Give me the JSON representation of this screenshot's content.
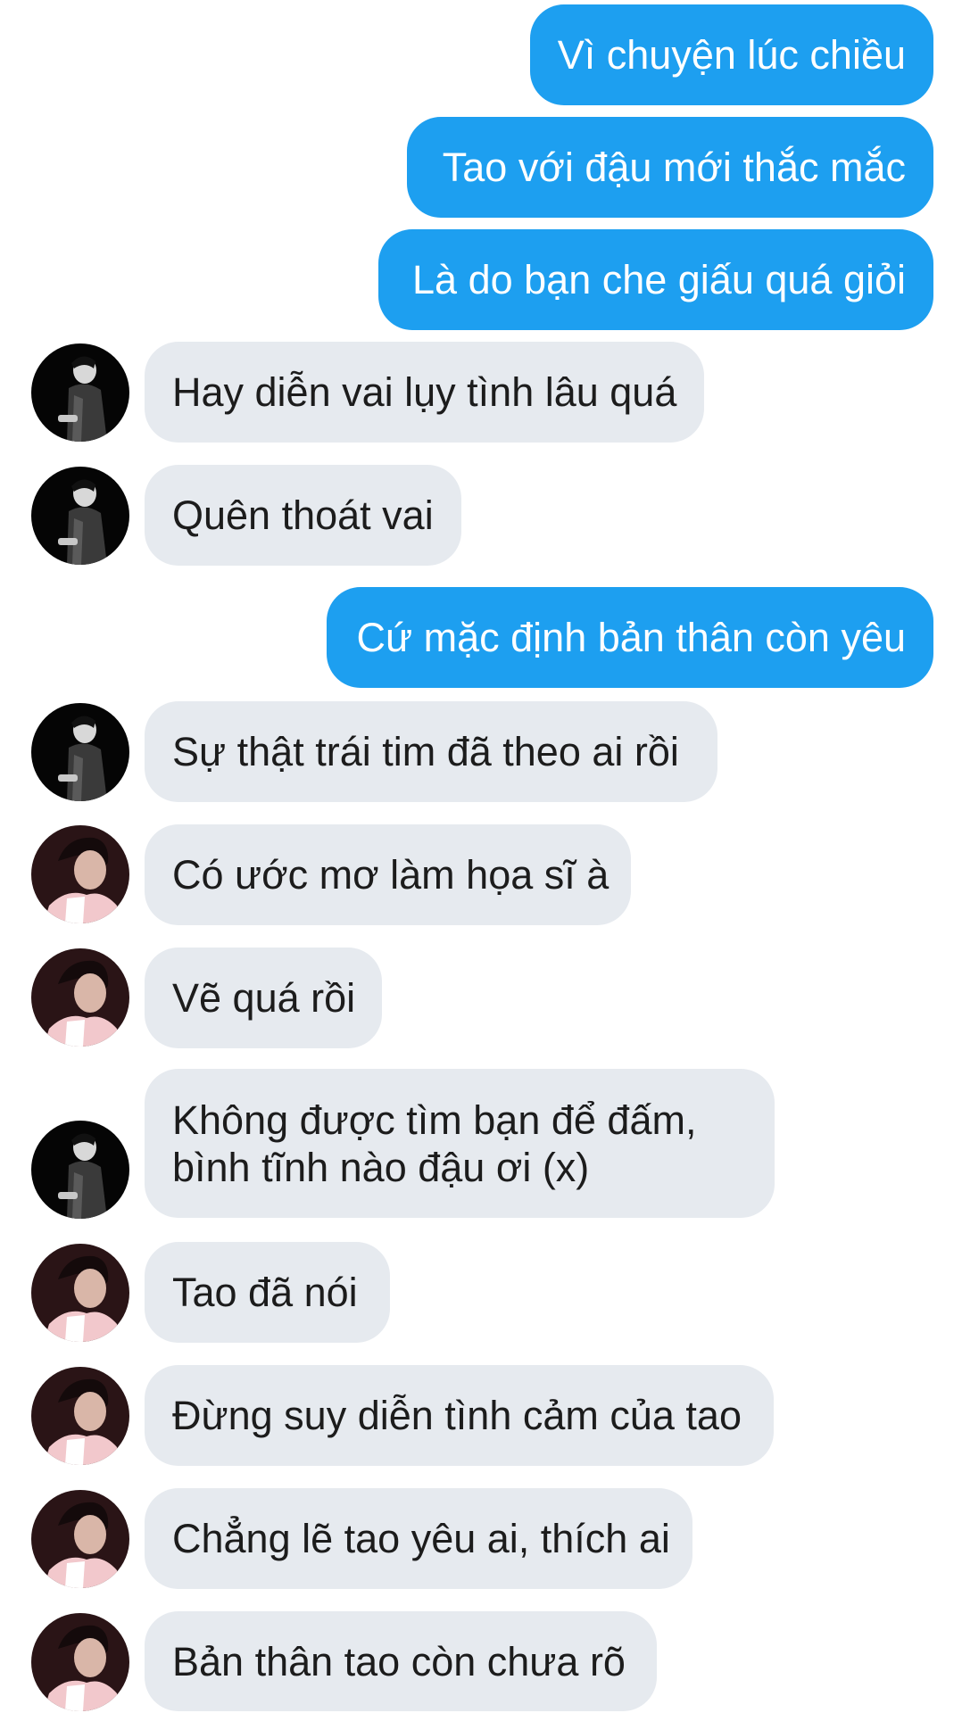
{
  "conversation": {
    "messages": [
      {
        "text": "Vì chuyện lúc chiều"
      },
      {
        "text": "Tao với đậu mới thắc mắc"
      },
      {
        "text": "Là do bạn che giấu quá giỏi"
      },
      {
        "text": "Hay diễn vai lụy tình lâu quá"
      },
      {
        "text": "Quên thoát vai"
      },
      {
        "text": "Cứ mặc định bản thân còn yêu"
      },
      {
        "text": "Sự thật trái tim đã theo ai rồi"
      },
      {
        "text": "Có ước mơ làm họa sĩ à"
      },
      {
        "text": "Vẽ quá rồi"
      },
      {
        "text": "Không được tìm bạn để đấm,\nbình tĩnh nào đậu ơi (x)"
      },
      {
        "text": "Tao đã nói"
      },
      {
        "text": "Đừng suy diễn tình cảm của tao"
      },
      {
        "text": "Chẳng lẽ tao yêu ai, thích ai"
      },
      {
        "text": "Bản thân tao còn chưa rõ"
      }
    ]
  },
  "colors": {
    "outgoing_bubble": "#1d9ff0",
    "incoming_bubble": "#e6eaef",
    "incoming_text": "#1c1c1c",
    "outgoing_text": "#ffffff"
  },
  "icons": {
    "avatar_dark": "person-in-dark-jacket-avatar",
    "avatar_pink": "person-in-pink-hoodie-avatar"
  }
}
